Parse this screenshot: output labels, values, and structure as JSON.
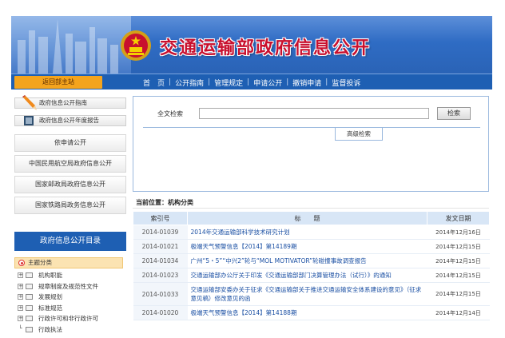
{
  "header": {
    "title": "交通运输部政府信息公开",
    "colors": {
      "title": "#c8102e",
      "banner": "#2f6cc4",
      "nav": "#1e5fb3",
      "accent": "#f4a41d"
    }
  },
  "nav": {
    "home": "返回部主站",
    "items": [
      "首　页",
      "公开指南",
      "管理规定",
      "申请公开",
      "撤销申请",
      "监督投诉"
    ]
  },
  "sidebar": {
    "guide": "政府信息公开指南",
    "report": "政府信息公开年度报告",
    "buttons": [
      "依申请公开",
      "中国民用航空局政府信息公开",
      "国家邮政局政府信息公开",
      "国家铁路局政务信息公开"
    ],
    "catalog_title": "政府信息公开目录",
    "tree_root": "主题分类",
    "tree": [
      "机构职能",
      "规章制度及规范性文件",
      "发展规划",
      "标准规范",
      "行政许可和非行政许可",
      "行政执法"
    ]
  },
  "search": {
    "label": "全文检索",
    "value": "",
    "button": "检索",
    "advanced": "高级检索"
  },
  "location": "当前位置：机构分类",
  "table": {
    "headers": [
      "索引号",
      "标　　题",
      "发文日期"
    ],
    "rows": [
      {
        "idx": "2014-01039",
        "title": "2014年交通运输部科学技术研究计划",
        "date": "2014年12月16日"
      },
      {
        "idx": "2014-01021",
        "title": "极端天气预警信息【2014】第14189期",
        "date": "2014年12月15日"
      },
      {
        "idx": "2014-01034",
        "title": "广州“5・5”“中兴2”轮与“MOL MOTIVATOR”轮碰撞事故调查报告",
        "date": "2014年12月15日"
      },
      {
        "idx": "2014-01023",
        "title": "交通运输部办公厅关于印发《交通运输部部门决算管理办法（试行）》的通知",
        "date": "2014年12月15日"
      },
      {
        "idx": "2014-01033",
        "title": "交通运输部安委办关于征求《交通运输部关于推进交通运输安全体系建设的意见》（征求意见稿）修改意见的函",
        "date": "2014年12月15日"
      },
      {
        "idx": "2014-01020",
        "title": "极端天气预警信息【2014】第14188期",
        "date": "2014年12月14日"
      }
    ]
  }
}
